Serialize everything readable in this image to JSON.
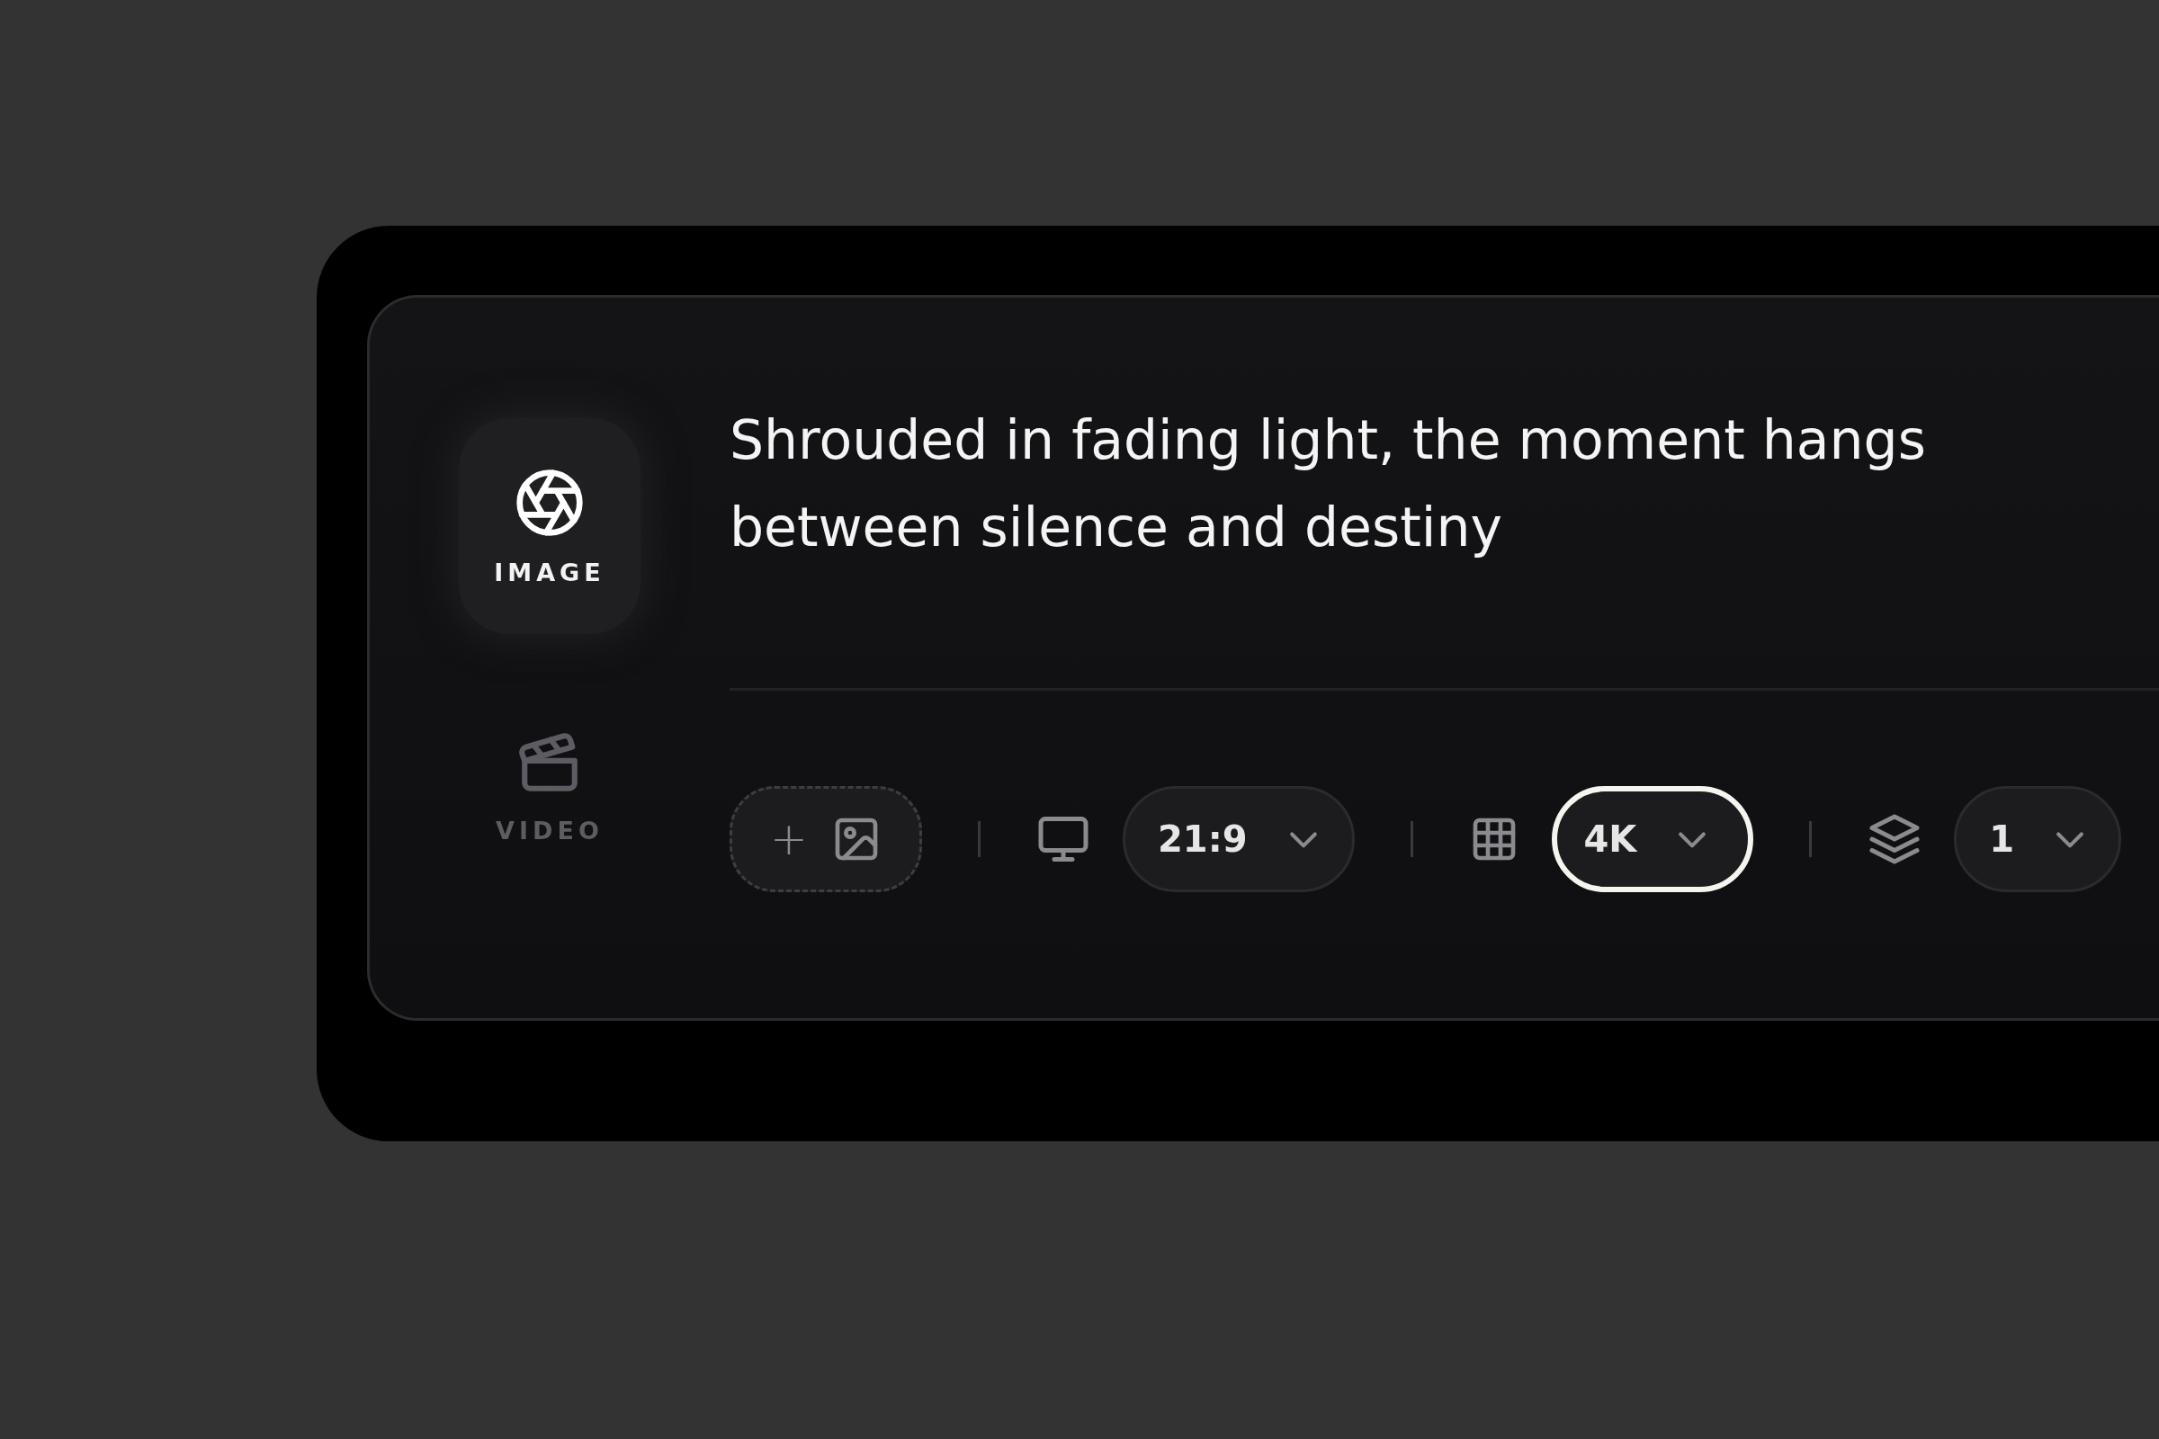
{
  "modes": [
    {
      "kind": "image",
      "label": "IMAGE",
      "selected": true
    },
    {
      "kind": "video",
      "label": "VIDEO",
      "selected": false
    }
  ],
  "prompt": "Shrouded in fading light, the moment hangs between silence and destiny",
  "toolbar": [
    {
      "kind": "upload",
      "plus": "+"
    },
    {
      "kind": "dropdown",
      "value": "21:9",
      "focused": false
    },
    {
      "kind": "dropdown",
      "value": "4K",
      "focused": true
    },
    {
      "kind": "dropdown",
      "value": "1",
      "focused": false
    }
  ]
}
